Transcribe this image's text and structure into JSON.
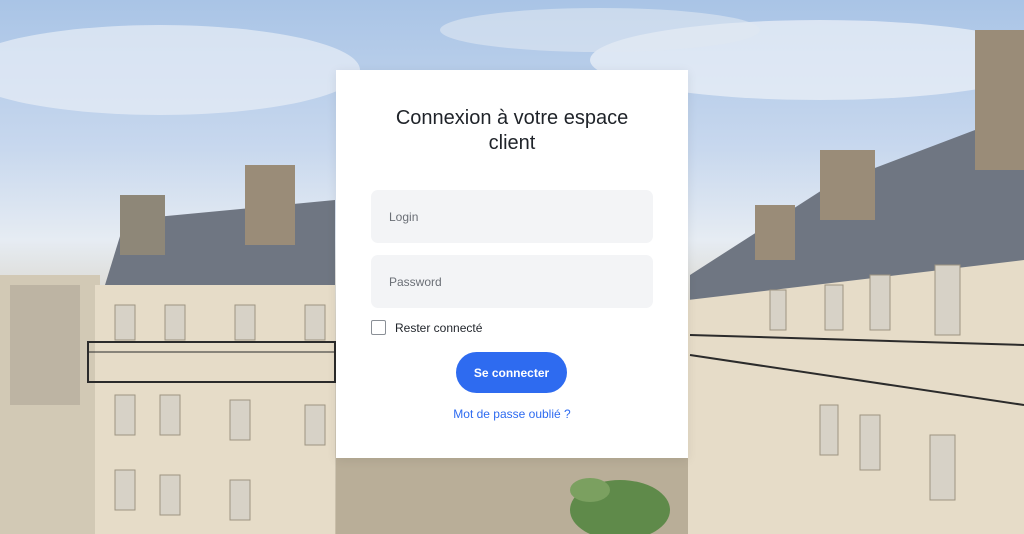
{
  "login_card": {
    "title": "Connexion à votre espace client",
    "login_placeholder": "Login",
    "password_placeholder": "Password",
    "remember_label": "Rester connecté",
    "remember_checked": false,
    "submit_label": "Se connecter",
    "forgot_link": "Mot de passe oublié ?"
  },
  "colors": {
    "accent": "#2e6bf0",
    "field_bg": "#f3f4f6",
    "card_bg": "#ffffff",
    "title_text": "#1f2329"
  },
  "background": {
    "image": "parisian-buildings-rooftops-photo"
  }
}
